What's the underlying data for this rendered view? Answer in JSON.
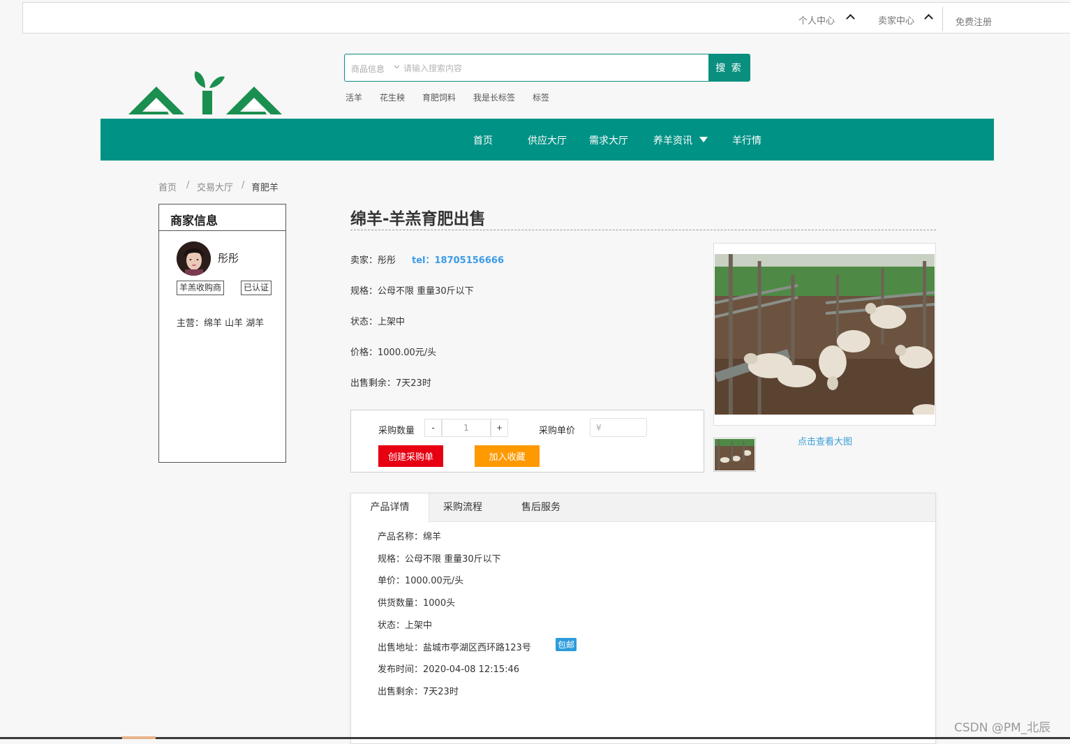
{
  "topbar": {
    "personal_center": "个人中心",
    "seller_center": "卖家中心",
    "register": "免费注册"
  },
  "search": {
    "category": "商品信息",
    "placeholder": "请输入搜索内容",
    "button": "搜 索",
    "hot_tags": [
      "活羊",
      "花生秧",
      "育肥饲料",
      "我是长标签",
      "标签"
    ]
  },
  "nav": {
    "items": [
      "首页",
      "供应大厅",
      "需求大厅",
      "养羊资讯",
      "羊行情"
    ]
  },
  "breadcrumb": [
    "首页",
    "交易大厅",
    "育肥羊"
  ],
  "merchant": {
    "title": "商家信息",
    "name": "彤彤",
    "tags": [
      "羊羔收购商",
      "已认证"
    ],
    "main_business": "主营：绵羊 山羊 湖羊"
  },
  "product": {
    "title": "绵羊-羊羔育肥出售",
    "seller": "卖家：彤彤",
    "tel": "tel：18705156666",
    "spec": "规格：公母不限  重量30斤以下",
    "status": "状态：上架中",
    "price": "价格：1000.00元/头",
    "remaining": "出售剩余：7天23时"
  },
  "purchase": {
    "qty_label": "采购数量",
    "minus": "-",
    "qty_value": "1",
    "plus": "+",
    "unit_price_label": "采购单价",
    "unit_price_placeholder": "¥",
    "create_order": "创建采购单",
    "add_favorite": "加入收藏",
    "create_color": "#e60012",
    "favorite_color": "#ff9900"
  },
  "gallery": {
    "view_large": "点击查看大图"
  },
  "tabs": [
    "产品详情",
    "采购流程",
    "售后服务"
  ],
  "details": {
    "name": "产品名称：绵羊",
    "spec": "规格：公母不限  重量30斤以下",
    "unit_price": "单价：1000.00元/头",
    "supply": "供货数量：1000头",
    "status": "状态：上架中",
    "address": "出售地址：盐城市亭湖区西环路123号",
    "free_shipping": "包邮",
    "publish_time": "发布时间：2020-04-08 12:15:46",
    "remaining": "出售剩余：7天23时"
  },
  "watermark": "CSDN @PM_北辰",
  "colors": {
    "brand": "#009285",
    "tel": "#3b9be8",
    "link": "#3a9fd8"
  }
}
